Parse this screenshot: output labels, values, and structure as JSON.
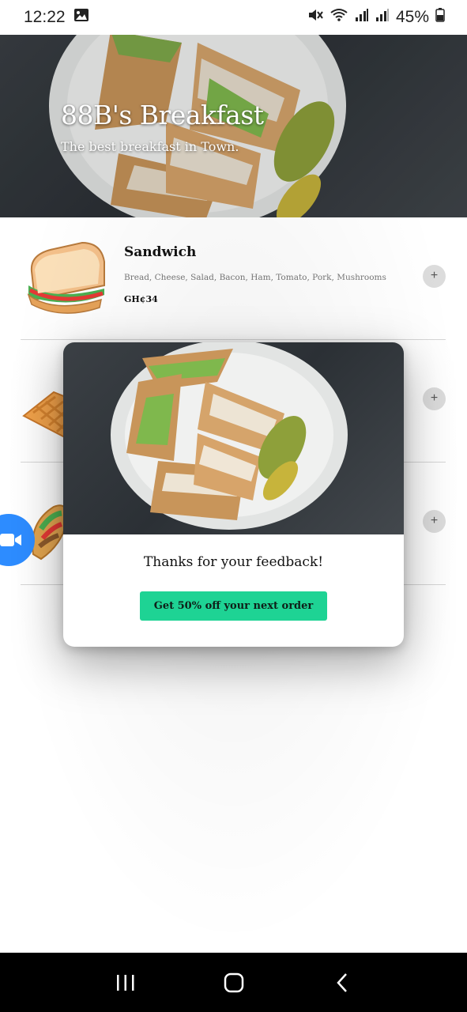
{
  "status_bar": {
    "time": "12:22",
    "battery": "45%",
    "icons": [
      "image-icon",
      "mute-icon",
      "wifi-icon",
      "signal-icon",
      "signal-icon",
      "battery-icon"
    ]
  },
  "hero": {
    "title": "88B's Breakfast",
    "subtitle": "The best breakfast in Town."
  },
  "menu": {
    "items": [
      {
        "name": "Sandwich",
        "description": "Bread, Cheese, Salad, Bacon, Ham, Tomato, Pork, Mushrooms",
        "price": "GH¢34",
        "icon": "sandwich-icon",
        "add_label": "+"
      },
      {
        "name": "",
        "description": "",
        "price": "",
        "icon": "waffle-icon",
        "add_label": "+"
      },
      {
        "name": "",
        "description": "",
        "price": "",
        "icon": "taco-icon",
        "add_label": "+"
      }
    ]
  },
  "modal": {
    "message": "Thanks for your feedback!",
    "cta_label": "Get 50% off your next order"
  },
  "fab": {
    "icon": "video-camera-icon"
  },
  "nav": {
    "icons": [
      "recents-icon",
      "home-icon",
      "back-icon"
    ]
  },
  "colors": {
    "accent": "#1ed394",
    "fab": "#2d8cff",
    "divider": "#d6d6d6"
  }
}
